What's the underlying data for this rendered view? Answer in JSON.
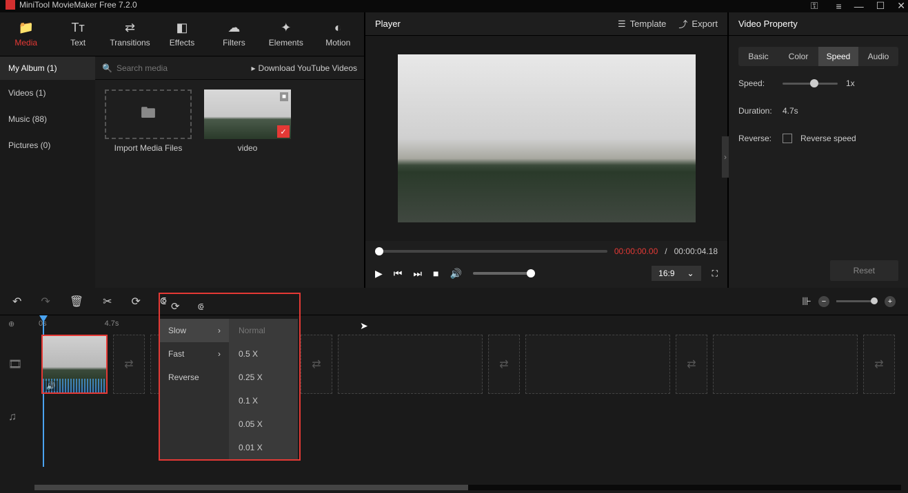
{
  "app": {
    "title": "MiniTool MovieMaker Free 7.2.0"
  },
  "top_tabs": [
    {
      "label": "Media",
      "icon": "folder"
    },
    {
      "label": "Text",
      "icon": "text"
    },
    {
      "label": "Transitions",
      "icon": "transition"
    },
    {
      "label": "Effects",
      "icon": "effects"
    },
    {
      "label": "Filters",
      "icon": "filters"
    },
    {
      "label": "Elements",
      "icon": "elements"
    },
    {
      "label": "Motion",
      "icon": "motion"
    }
  ],
  "sidebar": {
    "album": "My Album (1)",
    "items": [
      "Videos (1)",
      "Music (88)",
      "Pictures (0)"
    ]
  },
  "media": {
    "search_placeholder": "Search media",
    "yt_link": "Download YouTube Videos",
    "import_label": "Import Media Files",
    "video_label": "video"
  },
  "player": {
    "title": "Player",
    "template": "Template",
    "export": "Export",
    "time_current": "00:00:00.00",
    "time_sep": " / ",
    "time_total": "00:00:04.18",
    "aspect": "16:9"
  },
  "property": {
    "title": "Video Property",
    "tabs": [
      "Basic",
      "Color",
      "Speed",
      "Audio"
    ],
    "speed_label": "Speed:",
    "speed_value": "1x",
    "duration_label": "Duration:",
    "duration_value": "4.7s",
    "reverse_label": "Reverse:",
    "reverse_text": "Reverse speed",
    "reset": "Reset"
  },
  "timeline": {
    "ruler": [
      "0s",
      "4.7s"
    ]
  },
  "speed_menu": {
    "left": [
      "Slow",
      "Fast",
      "Reverse"
    ],
    "right": [
      "Normal",
      "0.5 X",
      "0.25 X",
      "0.1 X",
      "0.05 X",
      "0.01 X"
    ]
  }
}
